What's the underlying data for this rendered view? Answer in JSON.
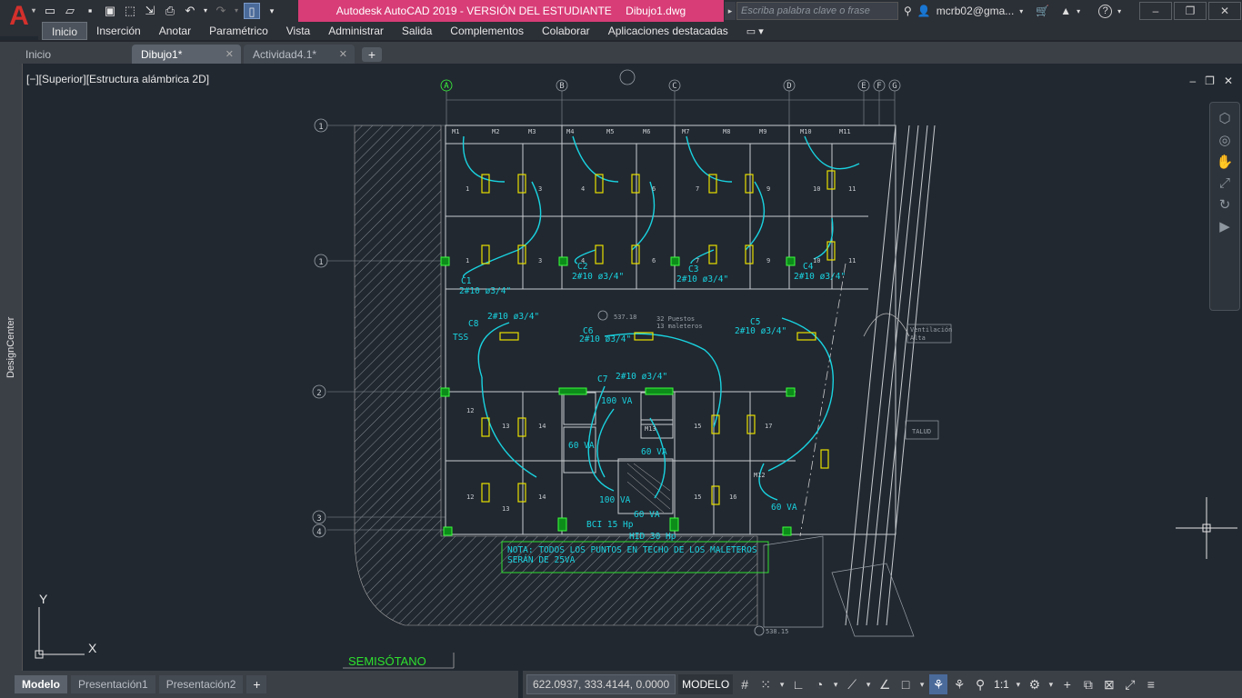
{
  "app": {
    "title_app": "Autodesk AutoCAD 2019 - VERSIÓN DEL ESTUDIANTE",
    "title_file": "Dibujo1.dwg",
    "logo_letter": "A",
    "search_placeholder": "Escriba palabra clave o frase",
    "user_name": "mcrb02@gma...",
    "accent_color": "#d83d77"
  },
  "ribbon": {
    "tabs": [
      "Inicio",
      "Inserción",
      "Anotar",
      "Paramétrico",
      "Vista",
      "Administrar",
      "Salida",
      "Complementos",
      "Colaborar",
      "Aplicaciones destacadas"
    ],
    "active": "Inicio"
  },
  "filetabs": {
    "start": "Inicio",
    "doc1": "Dibujo1*",
    "doc2": "Actividad4.1*"
  },
  "viewport": {
    "label": "[−][Superior][Estructura alámbrica 2D]",
    "side_panel": "DesignCenter",
    "ucs_x": "X",
    "ucs_y": "Y"
  },
  "drawing": {
    "grid_cols": [
      "A",
      "B",
      "C",
      "D",
      "E",
      "F",
      "G"
    ],
    "grid_rows": [
      "1",
      "1",
      "2",
      "3",
      "4"
    ],
    "circuits": [
      {
        "id": "C1",
        "spec": "2#10 ø3/4\""
      },
      {
        "id": "C2",
        "spec": "2#10 ø3/4\""
      },
      {
        "id": "C3",
        "spec": "2#10 ø3/4\""
      },
      {
        "id": "C4",
        "spec": "2#10 ø3/4\""
      },
      {
        "id": "C5",
        "spec": "2#10 ø3/4\""
      },
      {
        "id": "C6",
        "spec": "2#10 ø3/4\""
      },
      {
        "id": "C7",
        "spec": "2#10 ø3/4\""
      },
      {
        "id": "C8",
        "spec": "2#10 ø3/4\""
      }
    ],
    "stall_numbers_top": [
      "1",
      "3",
      "4",
      "6",
      "7",
      "9",
      "10",
      "11"
    ],
    "stall_numbers_mid": [
      "1",
      "3",
      "4",
      "6",
      "7",
      "9",
      "10",
      "11"
    ],
    "stall_numbers_bottom": [
      "12",
      "13",
      "14",
      "15",
      "17",
      "12",
      "13",
      "14",
      "15",
      "16"
    ],
    "lockers": [
      "M1",
      "M2",
      "M3",
      "M4",
      "M5",
      "M6",
      "M7",
      "M8",
      "M9",
      "M10",
      "M11"
    ],
    "locker_mid": "M13",
    "locker_right": "M12",
    "loads": [
      "100 VA",
      "60 VA",
      "60 VA",
      "100 VA",
      "60 VA",
      "60 VA"
    ],
    "bci": "BCI 15 Hp",
    "hid": "HID 30 Hp",
    "tss": "TSS",
    "parking_note": "32 Puestos\n13 maleteros",
    "elevation_center": "537.18",
    "elevation_bottom": "538.15",
    "vent_label": "Ventilación\nAlta",
    "talud_label": "TALUD",
    "note_line1": "NOTA: TODOS LOS PUNTOS EN TECHO DE LOS MALETEROS",
    "note_line2": "SERÁN DE 25VA",
    "floor_title": "SEMISÓTANO"
  },
  "layouts": {
    "tabs": [
      "Modelo",
      "Presentación1",
      "Presentación2"
    ],
    "active": "Modelo"
  },
  "status": {
    "coords": "622.0937, 333.4144, 0.0000",
    "space": "MODELO",
    "scale": "1:1"
  }
}
